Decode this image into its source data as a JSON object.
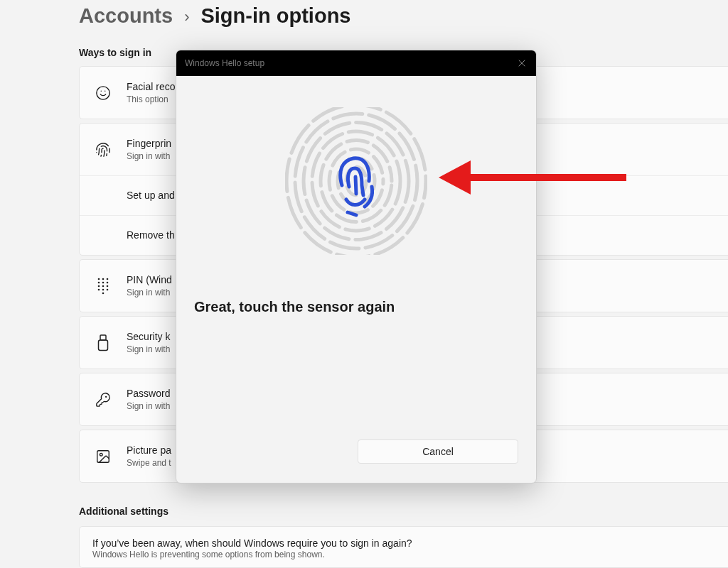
{
  "header": {
    "parent": "Accounts",
    "separator": "›",
    "title": "Sign-in options"
  },
  "section_title": "Ways to sign in",
  "options": [
    {
      "title": "Facial reco",
      "subtitle": "This option"
    },
    {
      "title": "Fingerprin",
      "subtitle": "Sign in with",
      "sub_items": [
        "Set up and",
        "Remove th"
      ]
    },
    {
      "title": "PIN (Wind",
      "subtitle": "Sign in with"
    },
    {
      "title": "Security k",
      "subtitle": "Sign in with"
    },
    {
      "title": "Password",
      "subtitle": "Sign in with"
    },
    {
      "title": "Picture pa",
      "subtitle": "Swipe and t"
    }
  ],
  "dialog": {
    "title": "Windows Hello setup",
    "message": "Great, touch the sensor again",
    "cancel": "Cancel"
  },
  "additional": {
    "title": "Additional settings",
    "question": "If you’ve been away, when should Windows require you to sign in again?",
    "note": "Windows Hello is preventing some options from being shown."
  }
}
